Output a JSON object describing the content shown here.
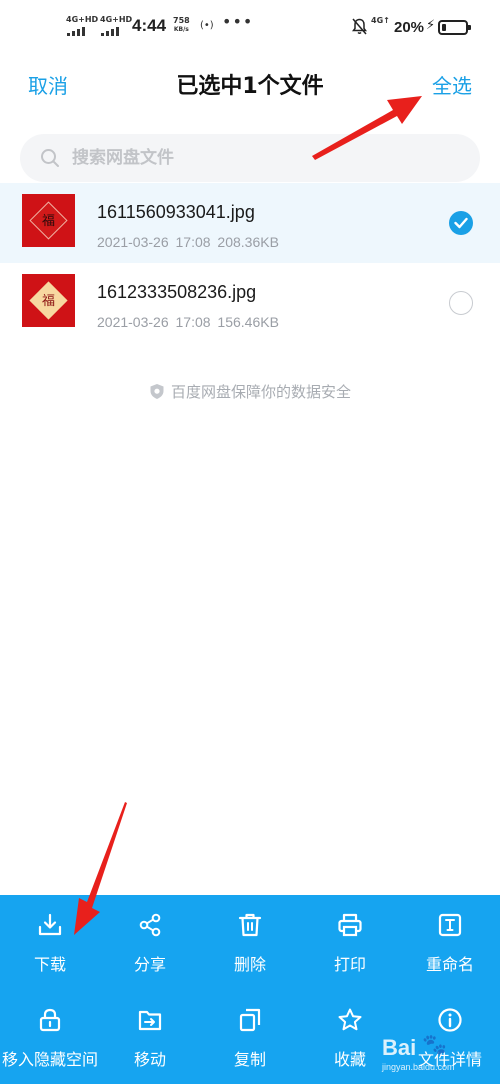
{
  "status_bar": {
    "net1": "4G+HD",
    "net2": "4G+HD",
    "time": "4:44",
    "speed_value": "758",
    "speed_unit": "KB/s",
    "dots": "•••",
    "net3": "4G↑",
    "battery_pct": "20%",
    "battery_level": 0.2
  },
  "header": {
    "cancel_label": "取消",
    "title": "已选中1个文件",
    "select_all_label": "全选"
  },
  "search": {
    "placeholder": "搜索网盘文件",
    "value": ""
  },
  "files": [
    {
      "name": "1611560933041.jpg",
      "meta": "2021-03-26  17:08  208.36KB",
      "selected": true,
      "thumb_char": "福"
    },
    {
      "name": "1612333508236.jpg",
      "meta": "2021-03-26  17:08  156.46KB",
      "selected": false,
      "thumb_char": "福"
    }
  ],
  "safety_note": "百度网盘保障你的数据安全",
  "actions_row1": [
    {
      "label": "下载",
      "icon": "download-icon"
    },
    {
      "label": "分享",
      "icon": "share-icon"
    },
    {
      "label": "删除",
      "icon": "trash-icon"
    },
    {
      "label": "打印",
      "icon": "print-icon"
    },
    {
      "label": "重命名",
      "icon": "rename-icon"
    }
  ],
  "actions_row2": [
    {
      "label": "移入隐藏空间",
      "icon": "lock-icon"
    },
    {
      "label": "移动",
      "icon": "move-folder-icon"
    },
    {
      "label": "复制",
      "icon": "copy-icon"
    },
    {
      "label": "收藏",
      "icon": "star-icon"
    },
    {
      "label": "文件详情",
      "icon": "info-icon"
    }
  ],
  "watermark": {
    "text": "Bai",
    "sub": "jingyan.baidu.com"
  },
  "colors": {
    "accent": "#1aa0e6",
    "action_bar": "#16a4f0",
    "annotation_arrow": "#e8201c"
  }
}
